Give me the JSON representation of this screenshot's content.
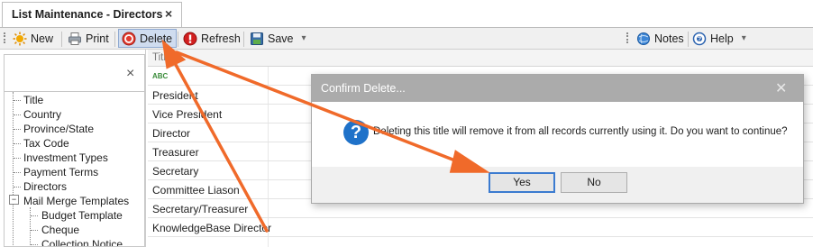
{
  "window": {
    "tab_title": "List Maintenance - Directors",
    "tab_close": "×"
  },
  "toolbar": {
    "new_label": "New",
    "print_label": "Print",
    "delete_label": "Delete",
    "refresh_label": "Refresh",
    "save_label": "Save",
    "notes_label": "Notes",
    "help_label": "Help",
    "dropdown_glyph": "▾"
  },
  "left_panel": {
    "close_glyph": "×",
    "tree": {
      "items": [
        "Title",
        "Country",
        "Province/State",
        "Tax Code",
        "Investment Types",
        "Payment Terms",
        "Directors"
      ],
      "mail_merge": {
        "expander": "−",
        "label": "Mail Merge Templates",
        "children": [
          "Budget Template",
          "Cheque",
          "Collection Notice"
        ]
      }
    }
  },
  "grid": {
    "header": "Title",
    "filter_row_glyph": "ABC",
    "rows": [
      "President",
      "Vice President",
      "Director",
      "Treasurer",
      "Secretary",
      "Committee Liason",
      "Secretary/Treasurer",
      "KnowledgeBase Director"
    ]
  },
  "dialog": {
    "title": "Confirm Delete...",
    "close_glyph": "✕",
    "icon": "question-icon",
    "question_glyph": "?",
    "message": "Deleting this title will remove it from all records currently using it.  Do you want to continue?",
    "yes_label": "Yes",
    "no_label": "No"
  },
  "colors": {
    "annotation_arrow": "#f06a2a",
    "dialog_titlebar": "#ababab",
    "focus_border": "#3b7bd0"
  }
}
